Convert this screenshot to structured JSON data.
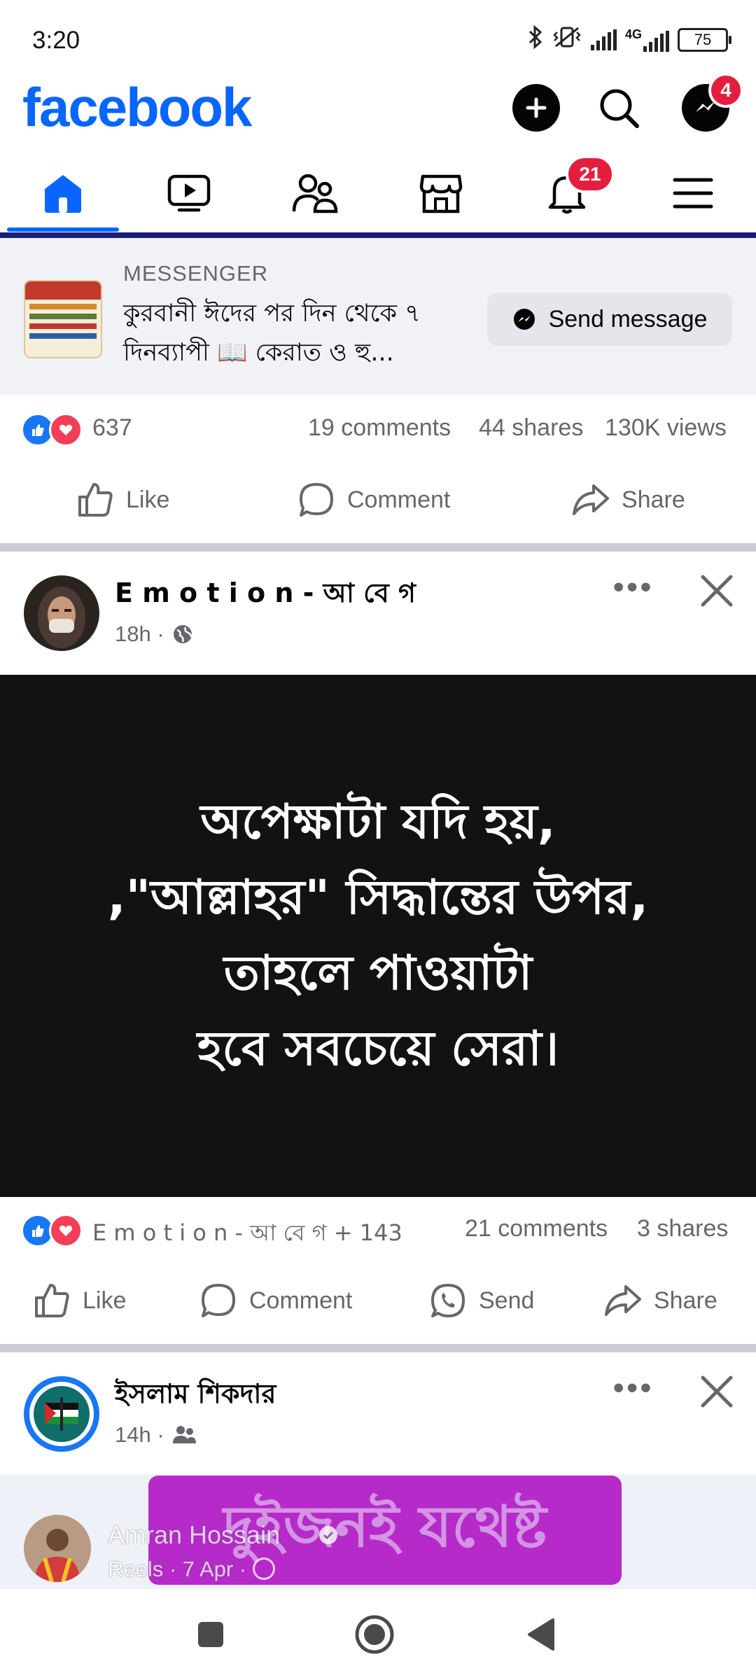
{
  "status_bar": {
    "time": "3:20",
    "network": "4G",
    "battery": "75"
  },
  "header": {
    "logo": "facebook",
    "messenger_badge": "4"
  },
  "tabs": {
    "notifications_badge": "21"
  },
  "ad": {
    "label": "MESSENGER",
    "text": "কুরবানী ঈদের পর দিন থেকে ৭ দিনব্যাপী 📖 কেরাত ও হু...",
    "button": "Send message"
  },
  "post1": {
    "reaction_count": "637",
    "comments": "19 comments",
    "shares": "44 shares",
    "views": "130K views",
    "actions": {
      "like": "Like",
      "comment": "Comment",
      "share": "Share"
    }
  },
  "post2": {
    "author": "E m o t i o n - আ বে গ",
    "time": "18h ·",
    "quote": "অপেক্ষাটা যদি হয়,\n,\"আল্লাহর\" সিদ্ধান্তের উপর,\nতাহলে পাওয়াটা\nহবে সবচেয়ে সেরা।",
    "reaction_text": "E m o t i o n - আ বে গ + 143",
    "comments": "21 comments",
    "shares": "3 shares",
    "actions": {
      "like": "Like",
      "comment": "Comment",
      "send": "Send",
      "share": "Share"
    }
  },
  "post3": {
    "author": "ইসলাম শিকদার",
    "time": "14h ·"
  },
  "reel": {
    "banner_text": "দুইজনই যথেষ্ট",
    "user": "Amran Hossain",
    "meta": "Reels · 7 Apr ·"
  },
  "colors": {
    "brand": "#0866ff",
    "badge": "#e41e3f",
    "secondary_text": "#65676b"
  }
}
